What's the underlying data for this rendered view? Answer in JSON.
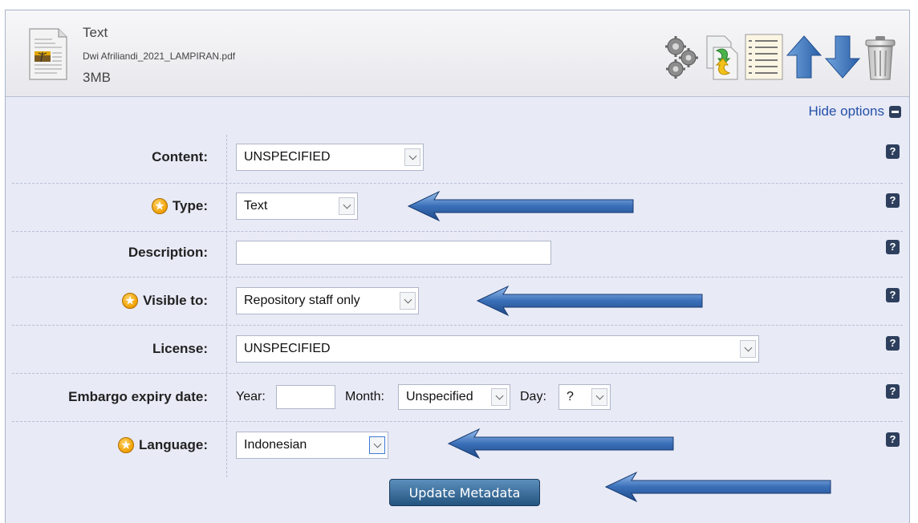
{
  "file": {
    "title": "Text",
    "filename": "Dwi Afriliandi_2021_LAMPIRAN.pdf",
    "size": "3MB"
  },
  "toolbar": {
    "icons": [
      "gears-icon",
      "replace-document-icon",
      "details-icon",
      "move-up-icon",
      "move-down-icon",
      "trash-icon"
    ]
  },
  "options_toggle": {
    "label": "Hide options"
  },
  "form": {
    "content": {
      "label": "Content:",
      "value": "UNSPECIFIED",
      "help": "?"
    },
    "type": {
      "label": "Type:",
      "value": "Text",
      "required": true,
      "help": "?"
    },
    "description": {
      "label": "Description:",
      "value": "",
      "help": "?"
    },
    "visible_to": {
      "label": "Visible to:",
      "value": "Repository staff only",
      "required": true,
      "help": "?"
    },
    "license": {
      "label": "License:",
      "value": "UNSPECIFIED",
      "help": "?"
    },
    "embargo": {
      "label": "Embargo expiry date:",
      "year_label": "Year:",
      "year_value": "",
      "month_label": "Month:",
      "month_value": "Unspecified",
      "day_label": "Day:",
      "day_value": "?",
      "help": "?"
    },
    "language": {
      "label": "Language:",
      "value": "Indonesian",
      "required": true,
      "help": "?"
    }
  },
  "submit": {
    "label": "Update Metadata"
  },
  "colors": {
    "panel_bg": "#e8eaf6",
    "link": "#2550a8",
    "button": "#23547f",
    "annotation_arrow": "#3a6fb8"
  }
}
